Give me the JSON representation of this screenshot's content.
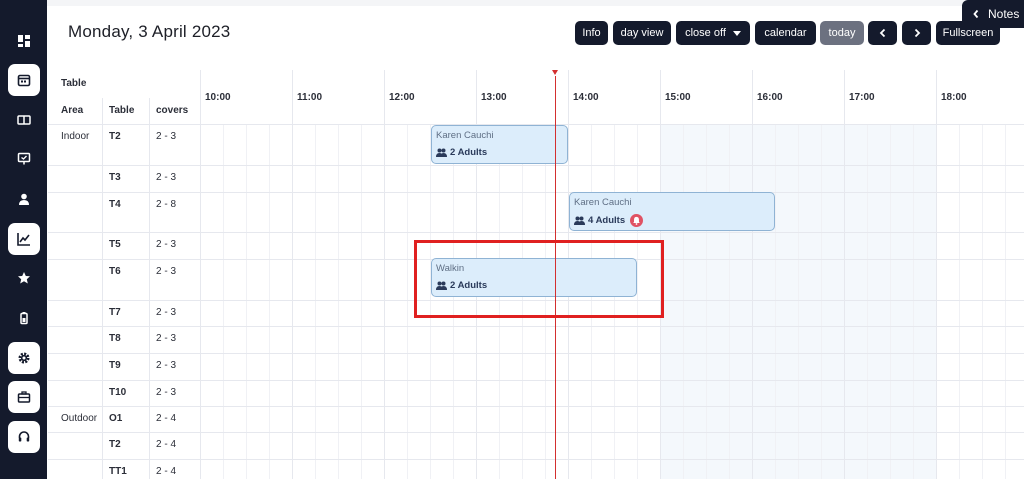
{
  "header": {
    "date_title": "Monday, 3 April 2023",
    "buttons": {
      "info": "Info",
      "day_view": "day view",
      "close_off": "close off",
      "calendar": "calendar",
      "today": "today",
      "fullscreen": "Fullscreen"
    },
    "notes_label": "Notes"
  },
  "sidebar": {
    "items": [
      {
        "icon": "dashboard-icon"
      },
      {
        "icon": "calendar-icon",
        "active": true
      },
      {
        "icon": "book-icon"
      },
      {
        "icon": "monitor-check-icon"
      },
      {
        "icon": "user-icon"
      },
      {
        "icon": "chart-icon",
        "active": true
      },
      {
        "icon": "star-icon"
      },
      {
        "icon": "battery-icon"
      },
      {
        "icon": "gear-icon",
        "active": true
      },
      {
        "icon": "toolbox-icon",
        "active": true
      },
      {
        "icon": "headset-icon",
        "active": true
      }
    ]
  },
  "grid": {
    "group_header": "Table",
    "col_area": "Area",
    "col_table": "Table",
    "col_covers": "covers",
    "times": [
      "10:00",
      "11:00",
      "12:00",
      "13:00",
      "14:00",
      "15:00",
      "16:00",
      "17:00",
      "18:00"
    ],
    "rows": [
      {
        "area": "Indoor",
        "table": "T2",
        "covers": "2 - 3"
      },
      {
        "area": "",
        "table": "T3",
        "covers": "2 - 3"
      },
      {
        "area": "",
        "table": "T4",
        "covers": "2 - 8"
      },
      {
        "area": "",
        "table": "T5",
        "covers": "2 - 3"
      },
      {
        "area": "",
        "table": "T6",
        "covers": "2 - 3"
      },
      {
        "area": "",
        "table": "T7",
        "covers": "2 - 3"
      },
      {
        "area": "",
        "table": "T8",
        "covers": "2 - 3"
      },
      {
        "area": "",
        "table": "T9",
        "covers": "2 - 3"
      },
      {
        "area": "",
        "table": "T10",
        "covers": "2 - 3"
      },
      {
        "area": "Outdoor",
        "table": "O1",
        "covers": "2 - 4"
      },
      {
        "area": "",
        "table": "T2",
        "covers": "2 - 4"
      },
      {
        "area": "",
        "table": "TT1",
        "covers": "2 - 4"
      }
    ]
  },
  "bookings": [
    {
      "name": "Karen Cauchi",
      "guests": "2 Adults",
      "alert": false
    },
    {
      "name": "Karen Cauchi",
      "guests": "4 Adults",
      "alert": true
    },
    {
      "name": "Walkin",
      "guests": "2 Adults",
      "alert": false
    }
  ]
}
